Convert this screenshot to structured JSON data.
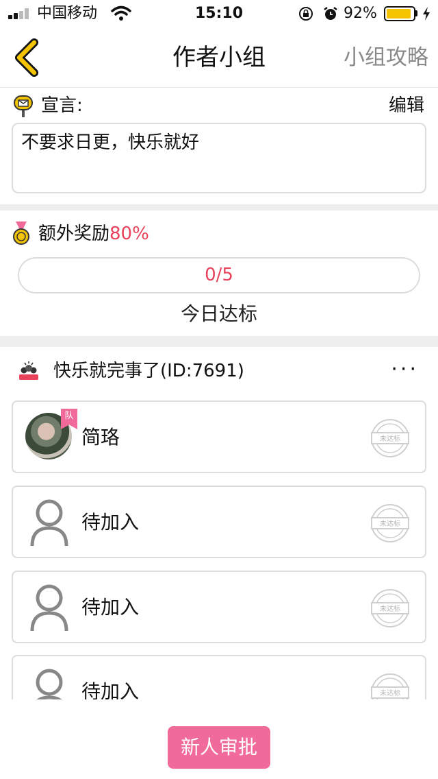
{
  "status_bar": {
    "carrier": "中国移动",
    "time": "15:10",
    "battery_percent": "92%",
    "battery_level": 0.92,
    "signal_icon": "signal-icon",
    "wifi_icon": "wifi-icon"
  },
  "nav": {
    "title": "作者小组",
    "right_link": "小组攻略",
    "back_icon": "chevron-left-icon"
  },
  "declaration": {
    "label": "宣言:",
    "edit": "编辑",
    "text": "不要求日更，快乐就好"
  },
  "reward": {
    "label": "额外奖励",
    "percent": "80%",
    "progress": "0/5",
    "progress_caption": "今日达标"
  },
  "team": {
    "name": "快乐就完事了(ID:7691)",
    "more": "···",
    "members": [
      {
        "name": "简珞",
        "leader_badge": "队",
        "status": "未达标"
      },
      {
        "name": "待加入",
        "status": "未达标"
      },
      {
        "name": "待加入",
        "status": "未达标"
      },
      {
        "name": "待加入",
        "status": "未达标"
      }
    ]
  },
  "footer": {
    "approve_button": "新人审批"
  },
  "colors": {
    "accent": "#f06a9a",
    "highlight": "#e8435a",
    "back_arrow": "#f5c400",
    "battery": "#f5c400"
  }
}
